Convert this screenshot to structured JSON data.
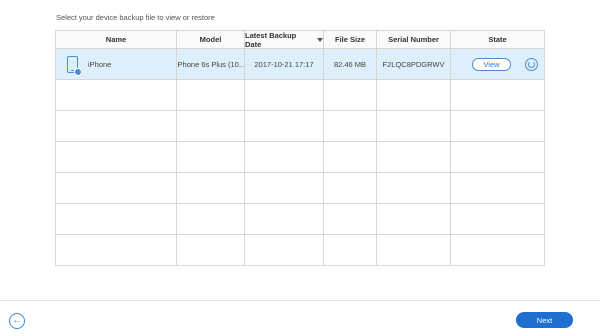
{
  "instruction": "Select your device backup file to view or restore",
  "table": {
    "headers": [
      "Name",
      "Model",
      "Latest Backup Date",
      "File Size",
      "Serial Number",
      "State"
    ],
    "rows": [
      {
        "name": "iPhone",
        "model": "iPhone 6s Plus (10...",
        "date": "2017-10-21 17:17",
        "size": "82.46 MB",
        "serial": "F2LQC8PDGRWV",
        "state_button": "View"
      }
    ]
  },
  "footer": {
    "next_label": "Next",
    "back_icon": "arrow-left-icon"
  },
  "colors": {
    "accent": "#1e6fcf",
    "selected_row": "#dceffa"
  }
}
